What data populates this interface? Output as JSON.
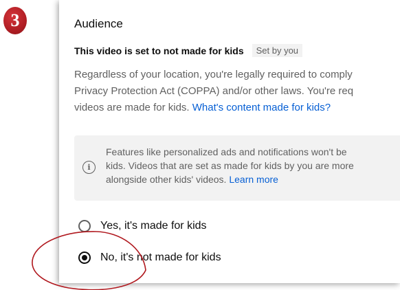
{
  "step_badge": "3",
  "audience": {
    "title": "Audience",
    "subtitle": "This video is set to not made for kids",
    "chip": "Set by you",
    "description_line1": "Regardless of your location, you're legally required to comply",
    "description_line2": "Privacy Protection Act (COPPA) and/or other laws. You're req",
    "description_line3": "videos are made for kids. ",
    "description_link": "What's content made for kids?"
  },
  "info": {
    "icon": "info-circle-icon",
    "line1": "Features like personalized ads and notifications won't be",
    "line2": "kids. Videos that are set as made for kids by you are more",
    "line3": "alongside other kids' videos. ",
    "link": "Learn more"
  },
  "options": [
    {
      "label": "Yes, it's made for kids",
      "selected": false
    },
    {
      "label": "No, it's not made for kids",
      "selected": true
    }
  ],
  "colors": {
    "badge": "#b01e24",
    "annotation_circle": "#b0181e",
    "link": "#065fd4"
  }
}
